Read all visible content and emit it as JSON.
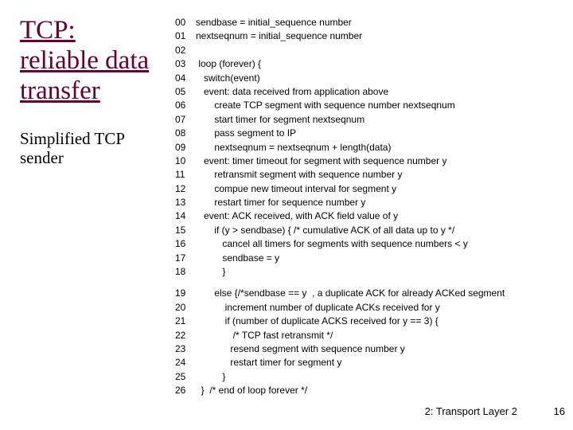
{
  "title": "TCP: reliable data transfer",
  "subtitle": "Simplified TCP sender",
  "code_lines": [
    {
      "n": "00",
      "t": "sendbase = initial_sequence number"
    },
    {
      "n": "01",
      "t": "nextseqnum = initial_sequence number"
    },
    {
      "n": "02",
      "t": ""
    },
    {
      "n": "03",
      "t": " loop (forever) {"
    },
    {
      "n": "04",
      "t": "   switch(event)"
    },
    {
      "n": "05",
      "t": "   event: data received from application above"
    },
    {
      "n": "06",
      "t": "       create TCP segment with sequence number nextseqnum"
    },
    {
      "n": "07",
      "t": "       start timer for segment nextseqnum"
    },
    {
      "n": "08",
      "t": "       pass segment to IP"
    },
    {
      "n": "09",
      "t": "       nextseqnum = nextseqnum + length(data)"
    },
    {
      "n": "10",
      "t": "   event: timer timeout for segment with sequence number y"
    },
    {
      "n": "11",
      "t": "       retransmit segment with sequence number y"
    },
    {
      "n": "12",
      "t": "       compue new timeout interval for segment y"
    },
    {
      "n": "13",
      "t": "       restart timer for sequence number y"
    },
    {
      "n": "14",
      "t": "   event: ACK received, with ACK field value of y"
    },
    {
      "n": "15",
      "t": "       if (y > sendbase) { /* cumulative ACK of all data up to y */"
    },
    {
      "n": "16",
      "t": "          cancel all timers for segments with sequence numbers < y"
    },
    {
      "n": "17",
      "t": "          sendbase = y"
    },
    {
      "n": "18",
      "t": "          }"
    }
  ],
  "code_lines2": [
    {
      "n": "19",
      "t": "       else {/*sendbase == y  , a duplicate ACK for already ACKed segment"
    },
    {
      "n": "20",
      "t": "           increment number of duplicate ACKs received for y"
    },
    {
      "n": "21",
      "t": "           if (number of duplicate ACKS received for y == 3) {"
    },
    {
      "n": "22",
      "t": "              /* TCP fast retransmit */"
    },
    {
      "n": "23",
      "t": "             resend segment with sequence number y"
    },
    {
      "n": "24",
      "t": "             restart timer for segment y"
    },
    {
      "n": "25",
      "t": "          }"
    },
    {
      "n": "26",
      "t": "  }  /* end of loop forever */"
    }
  ],
  "footer": "2: Transport Layer 2",
  "pagenum": "16"
}
